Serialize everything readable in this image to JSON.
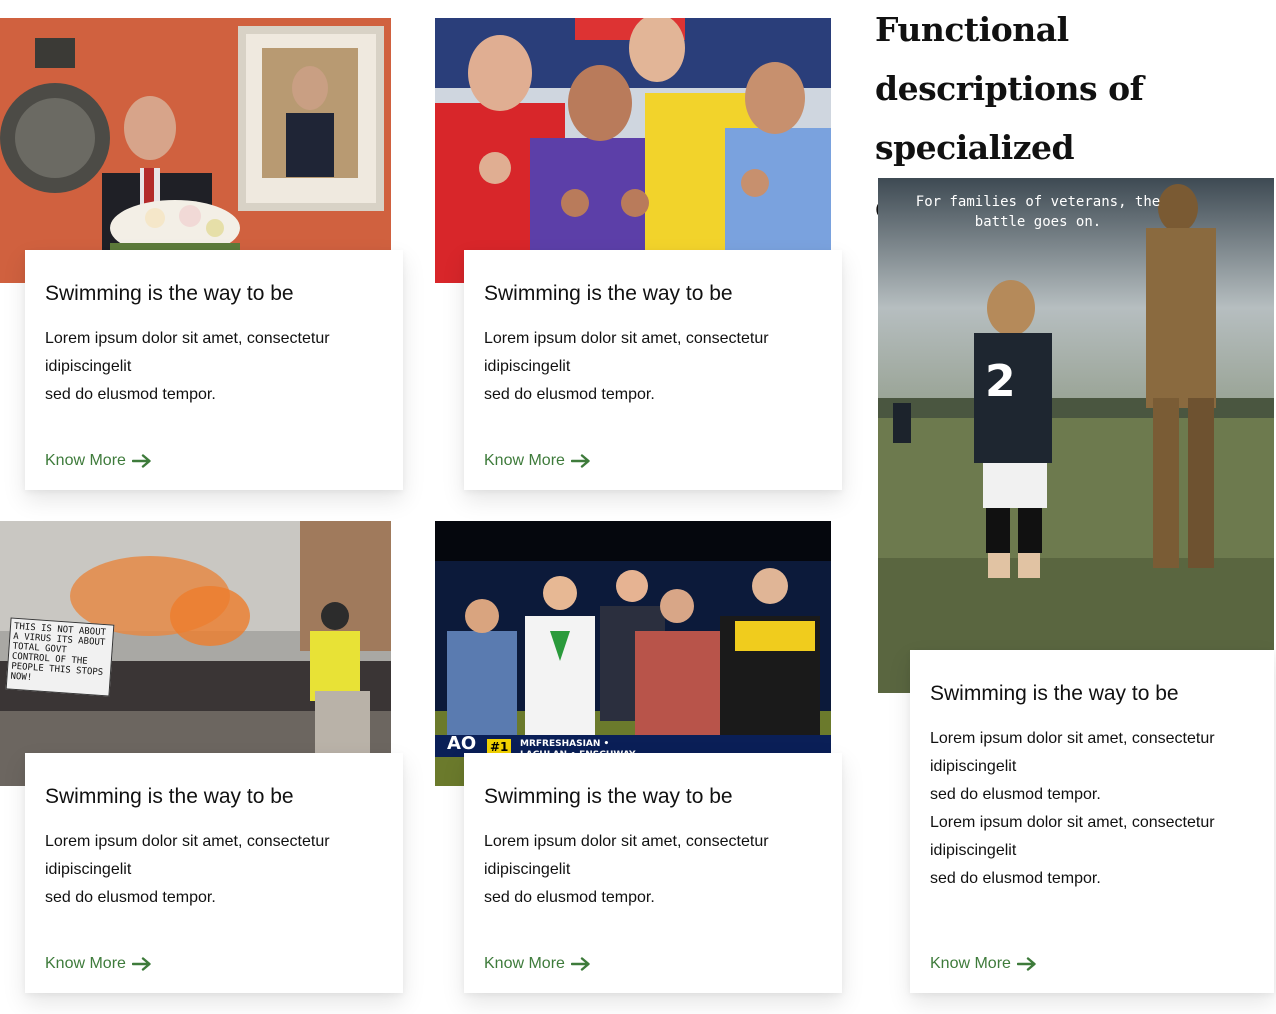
{
  "section": {
    "heading": "Functional descriptions of specialized committees"
  },
  "cards": [
    {
      "image_alt": "Speaker at NSW Parliament podium with portrait",
      "title": "Swimming is the way to be",
      "lines": [
        "Lorem ipsum dolor sit amet, consectetur",
        "idipiscingelit",
        "sed do elusmod tempor."
      ],
      "link": "Know More"
    },
    {
      "image_alt": "Four performers in colored shirts pointing",
      "title": "Swimming is the way to be",
      "lines": [
        "Lorem ipsum dolor sit amet, consectetur",
        "idipiscingelit",
        "sed do elusmod tempor."
      ],
      "link": "Know More"
    },
    {
      "image_alt": "Street protest with orange smoke and mounted police",
      "protest_sign": "THIS IS NOT ABOUT A VIRUS ITS ABOUT TOTAL GOVT CONTROL OF THE PEOPLE THIS STOPS NOW!",
      "title": "Swimming is the way to be",
      "lines": [
        "Lorem ipsum dolor sit amet, consectetur",
        "idipiscingelit",
        "sed do elusmod tempor."
      ],
      "link": "Know More"
    },
    {
      "image_alt": "Group of young men on a TV broadcast set",
      "tv_banner": "MRFRESHASIAN • LACHLAN • ENSCHWAY",
      "tv_rank": "#1",
      "tv_logo": "AO",
      "title": "Swimming is the way to be",
      "lines": [
        "Lorem ipsum dolor sit amet, consectetur",
        "idipiscingelit",
        "sed do elusmod tempor."
      ],
      "link": "Know More"
    },
    {
      "image_alt": "Boy in number 2 jersey beside bronze statue on a field",
      "poster_text": "For families of veterans, the battle goes on.",
      "jersey_number": "2",
      "title": "Swimming is the way to be",
      "lines": [
        "Lorem ipsum dolor sit amet, consectetur",
        "idipiscingelit",
        "sed do elusmod tempor.",
        "Lorem ipsum dolor sit amet, consectetur",
        "idipiscingelit",
        "sed do elusmod tempor."
      ],
      "link": "Know More"
    }
  ],
  "colors": {
    "link": "#3e7b3b",
    "title": "#111111"
  }
}
